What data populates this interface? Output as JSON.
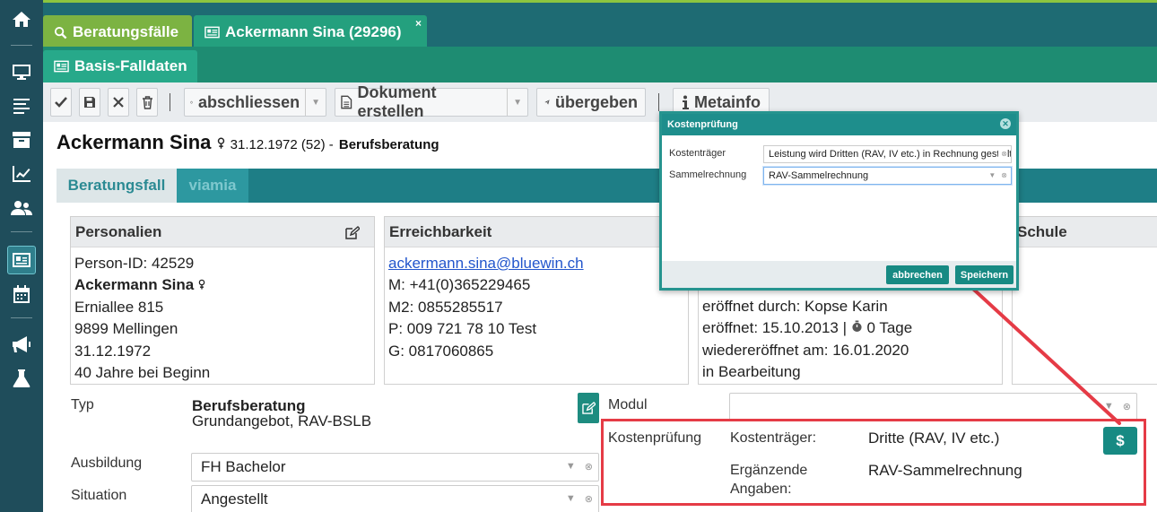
{
  "tabs": {
    "search_tab": "Beratungsfälle",
    "record_tab": "Ackermann Sina (29296)",
    "record_close": "×",
    "subtab": "Basis-Falldaten"
  },
  "toolbar": {
    "close_case": "abschliessen",
    "create_document": "Dokument erstellen",
    "hand_over": "übergeben",
    "metainfo": "Metainfo"
  },
  "person": {
    "name": "Ackermann Sina",
    "dob": "31.12.1972 (52) -",
    "case_type": "Berufsberatung"
  },
  "content_tabs": {
    "active": "Beratungsfall",
    "inactive": "viamia"
  },
  "personalien": {
    "title": "Personalien",
    "lines": [
      "Person-ID: 42529",
      "Ackermann Sina",
      "Erniallee 815",
      "9899 Mellingen",
      "31.12.1972",
      "40 Jahre bei Beginn"
    ]
  },
  "erreichbarkeit": {
    "title": "Erreichbarkeit",
    "email": "ackermann.sina@bluewin.ch",
    "lines": [
      "M: +41(0)365229465",
      "M2: 0855285517",
      "P: 009 721 78 10 Test",
      "G: 0817060865"
    ]
  },
  "status": {
    "lines": [
      "eröffnet durch: Kopse Karin",
      "eröffnet: 15.10.2013 |",
      "0 Tage",
      "wiedereröffnet am: 16.01.2020",
      "in Bearbeitung"
    ]
  },
  "schule": {
    "title": "Schule"
  },
  "form": {
    "typ_label": "Typ",
    "typ_value": "Berufsberatung",
    "typ_sub": "Grundangebot, RAV-BSLB",
    "ausbildung_label": "Ausbildung",
    "ausbildung_value": "FH Bachelor",
    "situation_label": "Situation",
    "situation_value": "Angestellt",
    "modul_label": "Modul",
    "modul_value": "",
    "kosten_label": "Kostenprüfung",
    "kostentraeger_label": "Kostenträger:",
    "kostentraeger_value": "Dritte (RAV, IV etc.)",
    "ergaenzende_label_1": "Ergänzende",
    "ergaenzende_label_2": "Angaben:",
    "ergaenzende_value": "RAV-Sammelrechnung",
    "dollar": "$"
  },
  "dialog": {
    "title": "Kostenprüfung",
    "kostentraeger_label": "Kostenträger",
    "kostentraeger_value": "Leistung wird Dritten (RAV, IV etc.) in Rechnung gestellt",
    "sammel_label": "Sammelrechnung",
    "sammel_value": "RAV-Sammelrechnung",
    "cancel": "abbrechen",
    "save": "Speichern"
  },
  "colors": {
    "sidebar": "#1f4d5b",
    "accent_teal": "#1e8e8c",
    "annotation_red": "#e53b46",
    "tab_green": "#7cb342"
  }
}
